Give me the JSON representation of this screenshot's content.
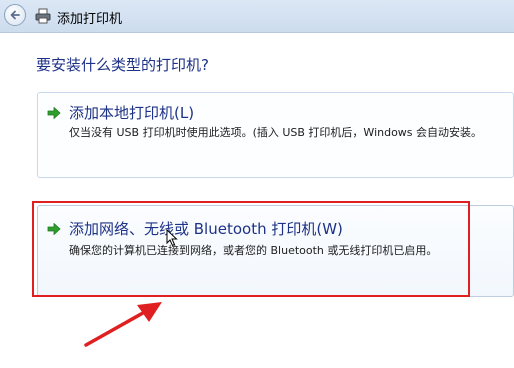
{
  "window": {
    "title": "添加打印机"
  },
  "main": {
    "question": "要安装什么类型的打印机?",
    "options": [
      {
        "title": "添加本地打印机(L)",
        "description": "仅当没有 USB 打印机时使用此选项。(插入 USB 打印机后，Windows 会自动安装。"
      },
      {
        "title": "添加网络、无线或 Bluetooth 打印机(W)",
        "description": "确保您的计算机已连接到网络，或者您的 Bluetooth 或无线打印机已启用。"
      }
    ]
  },
  "colors": {
    "highlight": "#e02020",
    "link_text": "#1e3287",
    "arrow_green": "#2e9e2e"
  },
  "icons": [
    "back-arrow-icon",
    "printer-icon",
    "green-arrow-icon",
    "mouse-cursor-icon"
  ]
}
